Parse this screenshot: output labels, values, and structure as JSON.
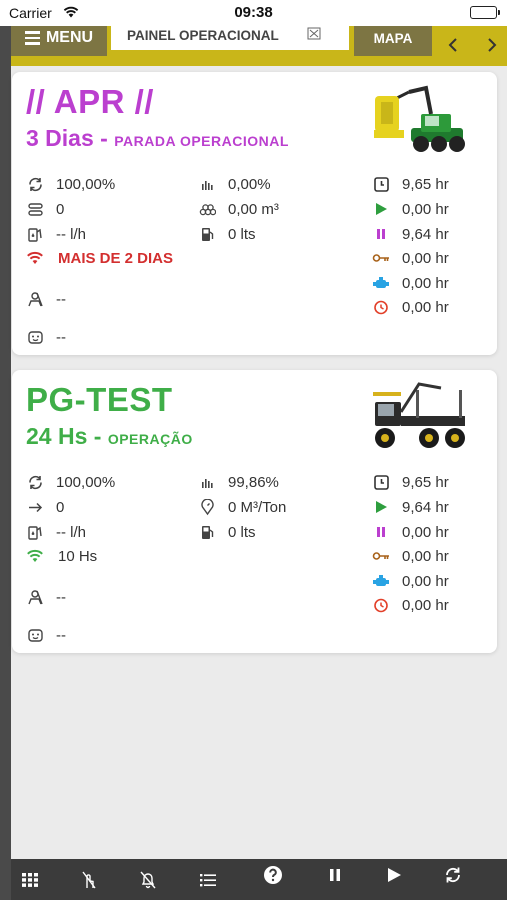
{
  "status_bar": {
    "carrier": "Carrier",
    "time": "09:38"
  },
  "nav": {
    "menu_label": "MENU",
    "tabs": [
      {
        "label": "PAINEL OPERACIONAL",
        "active": true
      },
      {
        "label": "MAPA",
        "active": false
      }
    ]
  },
  "machines": [
    {
      "name": "// APR //",
      "duration": "3 Dias - ",
      "state": "PARADA OPERACIONAL",
      "accent": "#bb3fcf",
      "machine_icon": "harvester",
      "left_stats": {
        "availability": "100,00%",
        "count": "0",
        "fuel_rate": "-- l/h",
        "connection": "MAIS DE 2 DIAS",
        "operator": "--",
        "supervisor": "--"
      },
      "mid_stats": {
        "efficiency": "0,00%",
        "production": "0,00 m³",
        "fuel": "0 lts"
      },
      "hours": {
        "engine": "9,65 hr",
        "working": "0,00 hr",
        "paused": "9,64 hr",
        "maintenance": "0,00 hr",
        "idle": "0,00 hr",
        "other": "0,00 hr"
      }
    },
    {
      "name": "PG-TEST",
      "duration": "24 Hs - ",
      "state": "OPERAÇÃO",
      "accent": "#3fae48",
      "machine_icon": "forwarder",
      "left_stats": {
        "availability": "100,00%",
        "count": "0",
        "fuel_rate": "-- l/h",
        "connection": "10 Hs",
        "operator": "--",
        "supervisor": "--"
      },
      "mid_stats": {
        "efficiency": "99,86%",
        "production": "0 M³/Ton",
        "fuel": "0 lts"
      },
      "hours": {
        "engine": "9,65 hr",
        "working": "9,64 hr",
        "paused": "0,00 hr",
        "maintenance": "0,00 hr",
        "idle": "0,00 hr",
        "other": "0,00 hr"
      }
    }
  ],
  "bottom_bar": {
    "icons": [
      "grid-icon",
      "no-touch-icon",
      "bell-off-icon",
      "list-icon",
      "help-icon",
      "pause-icon",
      "play-icon",
      "refresh-icon"
    ]
  }
}
